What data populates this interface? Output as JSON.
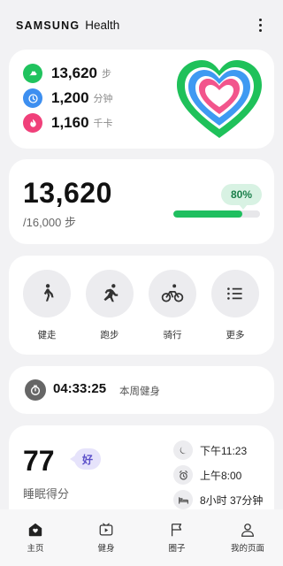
{
  "header": {
    "brand_bold": "SAMSUNG",
    "brand_light": "Health",
    "menu_icon": "more-vertical-icon"
  },
  "summary": {
    "metrics": [
      {
        "value": "13,620",
        "unit": "步",
        "icon": "shoe-icon",
        "color": "#20c35e"
      },
      {
        "value": "1,200",
        "unit": "分钟",
        "icon": "clock-icon",
        "color": "#3d8ff0"
      },
      {
        "value": "1,160",
        "unit": "千卡",
        "icon": "flame-icon",
        "color": "#f0407a"
      }
    ],
    "rings_icon": "activity-heart-rings-icon"
  },
  "steps": {
    "count": "13,620",
    "goal": "/16,000 步",
    "percent_label": "80%",
    "progress": 0.8,
    "accent": "#1fbf5f"
  },
  "activities": [
    {
      "label": "健走",
      "icon": "walking-icon"
    },
    {
      "label": "跑步",
      "icon": "running-icon"
    },
    {
      "label": "骑行",
      "icon": "cycling-icon"
    },
    {
      "label": "更多",
      "icon": "list-icon"
    }
  ],
  "workout": {
    "time": "04:33:25",
    "label": "本周健身",
    "icon": "stopwatch-icon"
  },
  "sleep": {
    "score": "77",
    "badge": "好",
    "label": "睡眠得分",
    "details": [
      {
        "text": "下午11:23",
        "icon": "moon-icon"
      },
      {
        "text": "上午8:00",
        "icon": "alarm-clock-icon"
      },
      {
        "text": "8小时 37分钟",
        "icon": "bed-icon"
      }
    ]
  },
  "nav": [
    {
      "label": "主页",
      "icon": "home-icon"
    },
    {
      "label": "健身",
      "icon": "fitness-icon"
    },
    {
      "label": "圈子",
      "icon": "flag-icon"
    },
    {
      "label": "我的页面",
      "icon": "person-icon"
    }
  ]
}
